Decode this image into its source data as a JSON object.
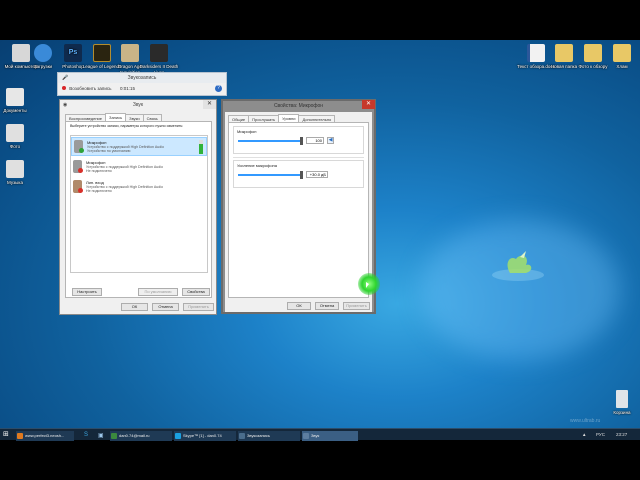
{
  "desktop_icons": [
    {
      "label": "Мой компьютер",
      "name": "desktop-icon-my-computer",
      "color": "#d7d7d7"
    },
    {
      "label": "Загрузки",
      "name": "desktop-icon-downloads",
      "color": "#3a8ad8"
    },
    {
      "label": "Photoshop",
      "name": "desktop-icon-photoshop",
      "color": "#0f2a4d"
    },
    {
      "label": "League of Legends",
      "name": "desktop-icon-league",
      "color": "#2a2410"
    },
    {
      "label": "Dragon Age Inquisition",
      "name": "desktop-icon-dragon-age",
      "color": "#c9b487"
    },
    {
      "label": "Darksiders II Death Lives",
      "name": "desktop-icon-darksiders",
      "color": "#2a2a2a"
    },
    {
      "label": "Документы",
      "name": "desktop-icon-documents",
      "color": "#e7e7e7"
    },
    {
      "label": "Фото",
      "name": "desktop-icon-photos",
      "color": "#e0e0e0"
    },
    {
      "label": "Музыка",
      "name": "desktop-icon-music",
      "color": "#e0e0e0"
    },
    {
      "label": "Текст обзора.docx",
      "name": "desktop-icon-docx",
      "color": "#f2f2f2"
    },
    {
      "label": "Новая папка",
      "name": "desktop-icon-new-folder",
      "color": "#e8c866"
    },
    {
      "label": "Фото к обзору",
      "name": "desktop-icon-review-photos",
      "color": "#e8c866"
    },
    {
      "label": "Хлам",
      "name": "desktop-icon-junk",
      "color": "#e8c866"
    },
    {
      "label": "Корзина",
      "name": "desktop-icon-recycle-bin",
      "color": "#e0e4e8"
    }
  ],
  "recorder": {
    "title": "Звукозапись",
    "resume_label": "Возобновить запись",
    "time": "0:01:15"
  },
  "sound_dialog": {
    "title": "Звук",
    "tabs": [
      "Воспроизведение",
      "Запись",
      "Звуки",
      "Связь"
    ],
    "active_tab": 1,
    "instruction": "Выберите устройство записи, параметры которого нужно изменить:",
    "devices": [
      {
        "name": "Микрофон",
        "line1": "Устройство с поддержкой High Definition Audio",
        "line2": "Устройство по умолчанию"
      },
      {
        "name": "Микрофон",
        "line1": "Устройство с поддержкой High Definition Audio",
        "line2": "Не подключено"
      },
      {
        "name": "Лин. вход",
        "line1": "Устройство с поддержкой High Definition Audio",
        "line2": "Не подключено"
      }
    ],
    "configure_label": "Настроить",
    "default_label": "По умолчанию",
    "properties_label": "Свойства",
    "ok_label": "ОК",
    "cancel_label": "Отмена",
    "apply_label": "Применить"
  },
  "mic_props": {
    "title": "Свойства: Микрофон",
    "tabs": [
      "Общие",
      "Прослушать",
      "Уровни",
      "Дополнительно"
    ],
    "active_tab": 2,
    "mic_label": "Микрофон",
    "mic_value": "100",
    "mic_level": 1.0,
    "boost_label": "Усиление микрофона",
    "boost_value": "+30.0 дБ",
    "boost_level": 1.0,
    "ok_label": "ОК",
    "cancel_label": "Отмена",
    "apply_label": "Применить"
  },
  "taskbar": {
    "items": [
      {
        "label": "www.perfect3.neosh...",
        "color": "#e07a1f"
      },
      {
        "label": "dan0.74@mail.ru",
        "color": "#3b8a3e"
      },
      {
        "label": "Skype™ [1] - dan0.74",
        "color": "#1aa0e0"
      },
      {
        "label": "Звукозапись",
        "color": "#4a6d8c"
      },
      {
        "label": "Звук",
        "color": "#5d7ea0"
      }
    ],
    "lang": "РУС",
    "time": "23:27"
  },
  "watermark": "www.ultrab.ru",
  "colors": {
    "taskbar": "#14273a",
    "accent": "#3399ff",
    "close": "#c7392b",
    "cursor": "#29d42f"
  }
}
